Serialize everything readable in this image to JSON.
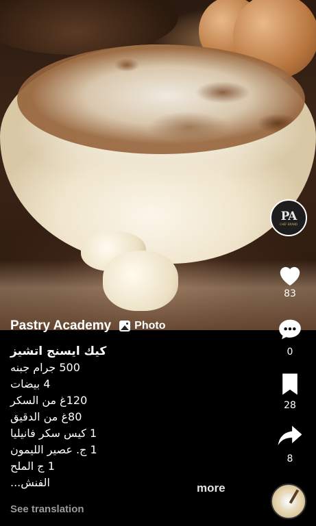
{
  "author": {
    "name": "Pastry Academy"
  },
  "post_type": {
    "label": "Photo",
    "icon": "photo-icon"
  },
  "profile": {
    "logo_text": "PA",
    "sub_text": "CHEF BRAND"
  },
  "actions": {
    "like": {
      "icon": "heart-icon",
      "count": "83"
    },
    "comment": {
      "icon": "comment-icon",
      "count": "0"
    },
    "save": {
      "icon": "bookmark-icon",
      "count": "28"
    },
    "share": {
      "icon": "share-icon",
      "count": "8"
    }
  },
  "caption": {
    "title": "كيك ايسنج اتشيز",
    "lines": [
      "500 جرام جبنه",
      "4 بيضات",
      "120غ من السكر",
      "80غ من الدقيق",
      "1 كيس سكر فانيليا",
      "1 ج. عصير الليمون",
      "1 ج الملح",
      "الفنش..."
    ]
  },
  "more_label": "more",
  "see_translation_label": "See translation",
  "colors": {
    "background": "#000000",
    "text": "#ffffff",
    "muted": "#9a9a9a"
  }
}
